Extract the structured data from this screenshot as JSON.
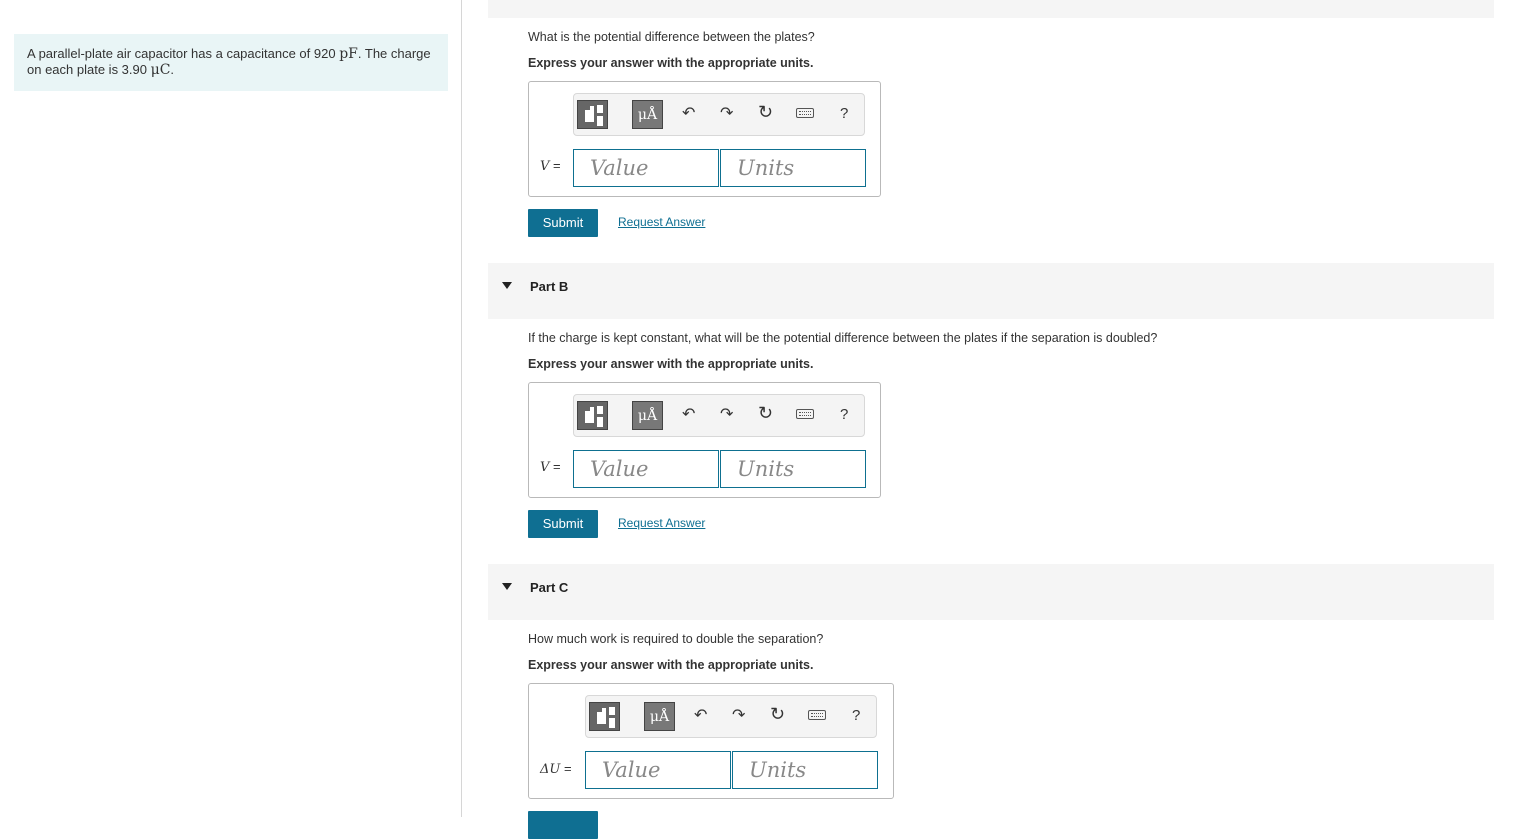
{
  "problem": {
    "text_before_c": "A parallel-plate air capacitor has a capacitance of 920 ",
    "c_unit": "pF",
    "text_mid": ". The charge on each plate is 3.90 ",
    "q_unit": "μC",
    "text_end": "."
  },
  "toolbar": {
    "units_label": "μÅ",
    "undo_glyph": "↶",
    "redo_glyph": "↷",
    "reset_glyph": "↻",
    "help_label": "?"
  },
  "common": {
    "instruction": "Express your answer with the appropriate units.",
    "value_placeholder": "Value",
    "units_placeholder": "Units",
    "submit_label": "Submit",
    "request_label": "Request Answer"
  },
  "part_a": {
    "question": "What is the potential difference between the plates?",
    "var_label": "V",
    "eq": " ="
  },
  "part_b": {
    "title": "Part B",
    "question": "If the charge is kept constant, what will be the potential difference between the plates if the separation is doubled?",
    "var_label": "V",
    "eq": " ="
  },
  "part_c": {
    "title": "Part C",
    "question": "How much work is required to double the separation?",
    "var_label": "ΔU",
    "eq": " ="
  }
}
